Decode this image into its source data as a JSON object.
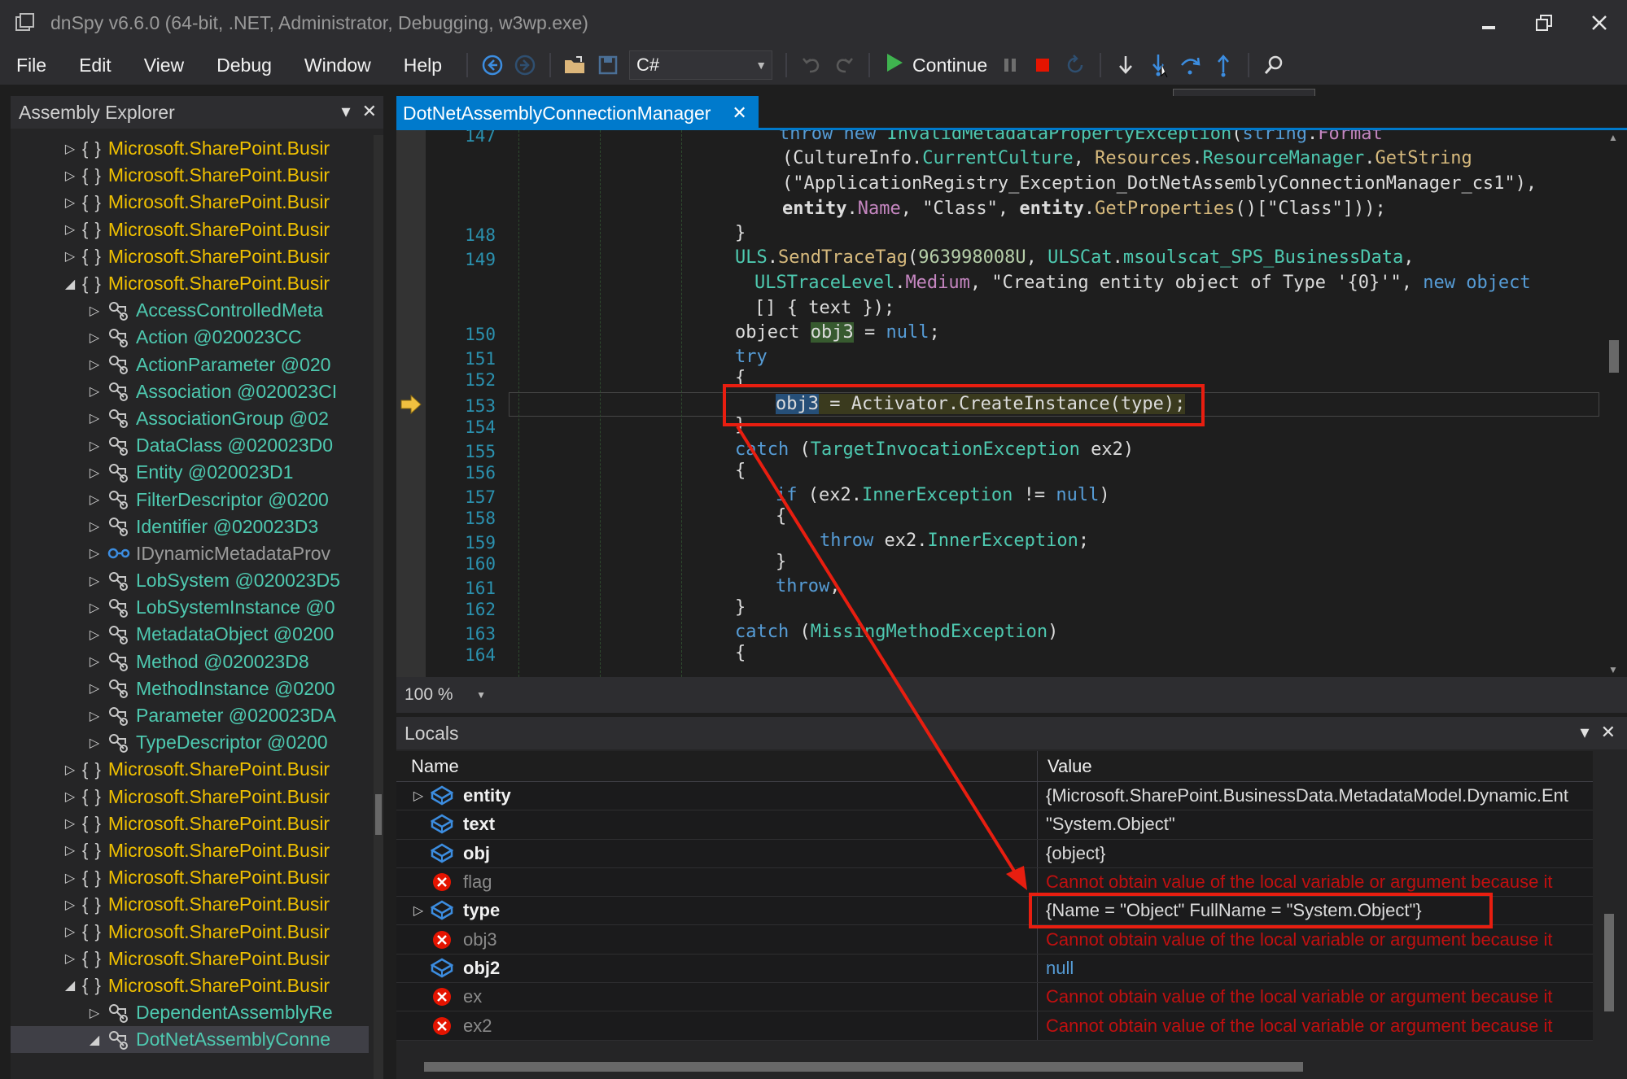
{
  "window": {
    "title": "dnSpy v6.6.0 (64-bit, .NET, Administrator, Debugging, w3wp.exe)",
    "controls": [
      "minimize",
      "restore",
      "close"
    ]
  },
  "menu": [
    "File",
    "Edit",
    "View",
    "Debug",
    "Window",
    "Help"
  ],
  "toolbar": {
    "language": "C#",
    "continue_label": "Continue",
    "tooltip": "Step Into (F11)"
  },
  "explorer": {
    "title": "Assembly Explorer",
    "items": [
      {
        "kind": "ns",
        "state": "collapsed",
        "label": "Microsoft.SharePoint.Busir"
      },
      {
        "kind": "ns",
        "state": "collapsed",
        "label": "Microsoft.SharePoint.Busir"
      },
      {
        "kind": "ns",
        "state": "collapsed",
        "label": "Microsoft.SharePoint.Busir"
      },
      {
        "kind": "ns",
        "state": "collapsed",
        "label": "Microsoft.SharePoint.Busir"
      },
      {
        "kind": "ns",
        "state": "collapsed",
        "label": "Microsoft.SharePoint.Busir"
      },
      {
        "kind": "ns",
        "state": "expanded",
        "label": "Microsoft.SharePoint.Busir"
      },
      {
        "kind": "cls",
        "label": "AccessControlledMeta"
      },
      {
        "kind": "cls",
        "label": "Action @020023CC"
      },
      {
        "kind": "cls",
        "label": "ActionParameter @020"
      },
      {
        "kind": "cls",
        "label": "Association @020023CI"
      },
      {
        "kind": "cls",
        "label": "AssociationGroup @02"
      },
      {
        "kind": "cls",
        "label": "DataClass @020023D0"
      },
      {
        "kind": "cls",
        "label": "Entity @020023D1"
      },
      {
        "kind": "cls",
        "label": "FilterDescriptor @0200"
      },
      {
        "kind": "cls",
        "label": "Identifier @020023D3"
      },
      {
        "kind": "iface",
        "label": "IDynamicMetadataProv"
      },
      {
        "kind": "cls",
        "label": "LobSystem @020023D5"
      },
      {
        "kind": "cls",
        "label": "LobSystemInstance @0"
      },
      {
        "kind": "cls",
        "label": "MetadataObject @0200"
      },
      {
        "kind": "cls",
        "label": "Method @020023D8"
      },
      {
        "kind": "cls",
        "label": "MethodInstance @0200"
      },
      {
        "kind": "cls",
        "label": "Parameter @020023DA"
      },
      {
        "kind": "cls",
        "label": "TypeDescriptor @0200"
      },
      {
        "kind": "ns",
        "state": "collapsed",
        "label": "Microsoft.SharePoint.Busir"
      },
      {
        "kind": "ns",
        "state": "collapsed",
        "label": "Microsoft.SharePoint.Busir"
      },
      {
        "kind": "ns",
        "state": "collapsed",
        "label": "Microsoft.SharePoint.Busir"
      },
      {
        "kind": "ns",
        "state": "collapsed",
        "label": "Microsoft.SharePoint.Busir"
      },
      {
        "kind": "ns",
        "state": "collapsed",
        "label": "Microsoft.SharePoint.Busir"
      },
      {
        "kind": "ns",
        "state": "collapsed",
        "label": "Microsoft.SharePoint.Busir"
      },
      {
        "kind": "ns",
        "state": "collapsed",
        "label": "Microsoft.SharePoint.Busir"
      },
      {
        "kind": "ns",
        "state": "collapsed",
        "label": "Microsoft.SharePoint.Busir"
      },
      {
        "kind": "ns",
        "state": "expanded",
        "label": "Microsoft.SharePoint.Busir"
      },
      {
        "kind": "cls",
        "label": "DependentAssemblyRe"
      },
      {
        "kind": "cls",
        "state": "expanded",
        "selected": true,
        "label": "DotNetAssemblyConne"
      }
    ]
  },
  "editor": {
    "tab_label": "DotNetAssemblyConnectionManager",
    "zoom": "100 %",
    "line_numbers": [
      "147",
      "148",
      "149",
      "150",
      "151",
      "152",
      "153",
      "154",
      "155",
      "156",
      "157",
      "158",
      "159",
      "160",
      "161",
      "162",
      "163",
      "164"
    ],
    "code": [
      [
        {
          "t": "throw new ",
          "c": "kw"
        },
        {
          "t": "InvalidMetadataPropertyException",
          "c": "ty"
        },
        {
          "t": "(",
          "c": "cm"
        },
        {
          "t": "string",
          "c": "kw"
        },
        {
          "t": ".",
          "c": "cm"
        },
        {
          "t": "Format",
          "c": "mb"
        }
      ],
      [
        {
          "t": "(",
          "c": "cm"
        },
        {
          "t": "CultureInfo",
          "c": "cm"
        },
        {
          "t": ".",
          "c": "cm"
        },
        {
          "t": "CurrentCulture",
          "c": "ty"
        },
        {
          "t": ", ",
          "c": "cm"
        },
        {
          "t": "Resources",
          "c": "pr"
        },
        {
          "t": ".",
          "c": "cm"
        },
        {
          "t": "ResourceManager",
          "c": "ty"
        },
        {
          "t": ".",
          "c": "cm"
        },
        {
          "t": "GetString",
          "c": "pr"
        }
      ],
      [
        {
          "t": "(\"ApplicationRegistry_Exception_DotNetAssemblyConnectionManager_cs1\"),",
          "c": "cm"
        }
      ],
      [
        {
          "t": "entity",
          "c": "cm",
          "b": true
        },
        {
          "t": ".",
          "c": "cm"
        },
        {
          "t": "Name",
          "c": "mb"
        },
        {
          "t": ", \"Class\", ",
          "c": "cm"
        },
        {
          "t": "entity",
          "c": "cm",
          "b": true
        },
        {
          "t": ".",
          "c": "cm"
        },
        {
          "t": "GetProperties",
          "c": "pr"
        },
        {
          "t": "()[\"Class\"]));",
          "c": "cm"
        }
      ],
      [
        {
          "t": "}",
          "c": "cm"
        }
      ],
      [
        {
          "t": "ULS",
          "c": "ty"
        },
        {
          "t": ".",
          "c": "cm"
        },
        {
          "t": "SendTraceTag",
          "c": "pr"
        },
        {
          "t": "(",
          "c": "cm"
        },
        {
          "t": "963998008U",
          "c": "nm"
        },
        {
          "t": ", ",
          "c": "cm"
        },
        {
          "t": "ULSCat",
          "c": "ty"
        },
        {
          "t": ".",
          "c": "cm"
        },
        {
          "t": "msoulscat_SPS_BusinessData",
          "c": "ty"
        },
        {
          "t": ",",
          "c": "cm"
        }
      ],
      [
        {
          "t": "ULSTraceLevel",
          "c": "ty"
        },
        {
          "t": ".",
          "c": "cm"
        },
        {
          "t": "Medium",
          "c": "mb"
        },
        {
          "t": ", \"Creating entity object of Type '{0}'\", ",
          "c": "cm"
        },
        {
          "t": "new object",
          "c": "kw"
        }
      ],
      [
        {
          "t": "[] { text });",
          "c": "cm"
        }
      ],
      [
        {
          "t": "object ",
          "c": "cm"
        },
        {
          "t": "obj3",
          "c": "cm",
          "h": "green"
        },
        {
          "t": " = ",
          "c": "cm"
        },
        {
          "t": "null",
          "c": "kw"
        },
        {
          "t": ";",
          "c": "cm"
        }
      ],
      [
        {
          "t": "try",
          "c": "kw"
        }
      ],
      [
        {
          "t": "{",
          "c": "cm"
        }
      ],
      [
        {
          "t": "obj3",
          "c": "cm",
          "h": "sel"
        },
        {
          "t": " = Activator.CreateInstance(type);",
          "c": "cm",
          "h": "bg"
        }
      ],
      [
        {
          "t": "}",
          "c": "cm"
        }
      ],
      [
        {
          "t": "catch ",
          "c": "kw"
        },
        {
          "t": "(",
          "c": "cm"
        },
        {
          "t": "TargetInvocationException",
          "c": "ty"
        },
        {
          "t": " ex2)",
          "c": "cm"
        }
      ],
      [
        {
          "t": "{",
          "c": "cm"
        }
      ],
      [
        {
          "t": "if ",
          "c": "kw"
        },
        {
          "t": "(ex2.",
          "c": "cm"
        },
        {
          "t": "InnerException",
          "c": "ty"
        },
        {
          "t": " != ",
          "c": "cm"
        },
        {
          "t": "null",
          "c": "kw"
        },
        {
          "t": ")",
          "c": "cm"
        }
      ],
      [
        {
          "t": "{",
          "c": "cm"
        }
      ],
      [
        {
          "t": "throw ",
          "c": "kw"
        },
        {
          "t": "ex2.",
          "c": "cm"
        },
        {
          "t": "InnerException",
          "c": "ty"
        },
        {
          "t": ";",
          "c": "cm"
        }
      ],
      [
        {
          "t": "}",
          "c": "cm"
        }
      ],
      [
        {
          "t": "throw",
          "c": "kw"
        },
        {
          "t": ";",
          "c": "cm"
        }
      ],
      [
        {
          "t": "}",
          "c": "cm"
        }
      ],
      [
        {
          "t": "catch ",
          "c": "kw"
        },
        {
          "t": "(",
          "c": "cm"
        },
        {
          "t": "MissingMethodException",
          "c": "ty"
        },
        {
          "t": ")",
          "c": "cm"
        }
      ],
      [
        {
          "t": "{",
          "c": "cm"
        }
      ]
    ]
  },
  "locals": {
    "title": "Locals",
    "columns": [
      "Name",
      "Value"
    ],
    "rows": [
      {
        "expandable": true,
        "icon": "field",
        "name": "entity",
        "bold": true,
        "value": "{Microsoft.SharePoint.BusinessData.MetadataModel.Dynamic.Ent",
        "vstyle": "normal"
      },
      {
        "expandable": false,
        "icon": "field",
        "name": "text",
        "bold": true,
        "value": "\"System.Object\"",
        "vstyle": "normal"
      },
      {
        "expandable": false,
        "icon": "field",
        "name": "obj",
        "bold": true,
        "value": "{object}",
        "vstyle": "normal"
      },
      {
        "expandable": false,
        "icon": "error",
        "name": "flag",
        "bold": false,
        "value": "Cannot obtain value of the local variable or argument because it",
        "vstyle": "err"
      },
      {
        "expandable": true,
        "icon": "field",
        "name": "type",
        "bold": true,
        "value": "{Name = \"Object\" FullName = \"System.Object\"}",
        "vstyle": "normal"
      },
      {
        "expandable": false,
        "icon": "error",
        "name": "obj3",
        "bold": false,
        "value": "Cannot obtain value of the local variable or argument because it",
        "vstyle": "err"
      },
      {
        "expandable": false,
        "icon": "field",
        "name": "obj2",
        "bold": true,
        "value": "null",
        "vstyle": "null"
      },
      {
        "expandable": false,
        "icon": "error",
        "name": "ex",
        "bold": false,
        "value": "Cannot obtain value of the local variable or argument because it",
        "vstyle": "err"
      },
      {
        "expandable": false,
        "icon": "error",
        "name": "ex2",
        "bold": false,
        "value": "Cannot obtain value of the local variable or argument because it",
        "vstyle": "err"
      }
    ]
  },
  "colors": {
    "accent": "#007acc",
    "annotation": "#e81e10",
    "namespace": "#f0c000",
    "class": "#4ec9b0"
  }
}
